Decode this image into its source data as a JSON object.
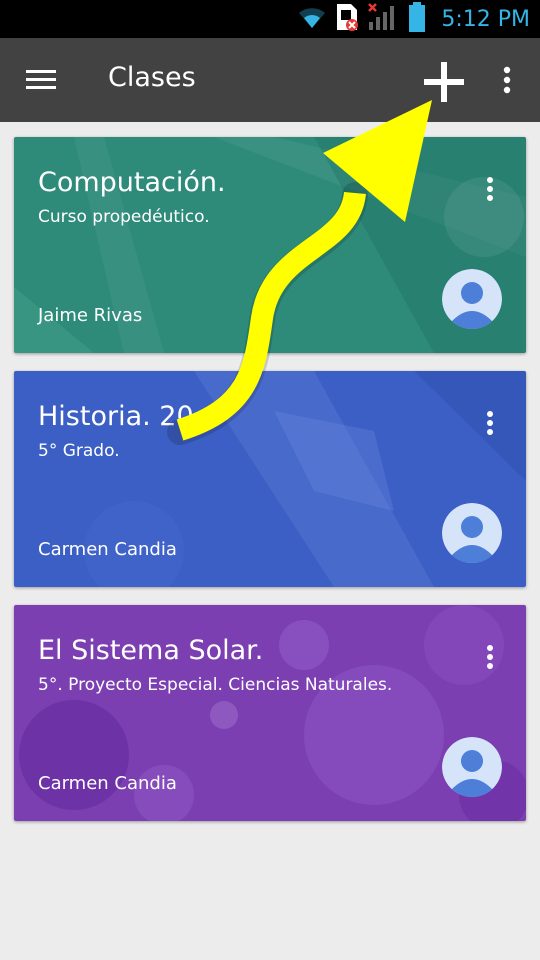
{
  "status_bar": {
    "time": "5:12 PM",
    "icons": [
      "wifi-icon",
      "sim-error-icon",
      "signal-off-icon",
      "battery-icon"
    ]
  },
  "app_bar": {
    "title": "Clases",
    "menu_icon": "hamburger-menu-icon",
    "add_icon": "plus-icon",
    "overflow_icon": "more-vert-icon"
  },
  "classes": [
    {
      "title": "Computación.",
      "subtitle": "Curso propedéutico.",
      "owner": "Jaime Rivas",
      "color": "#2e8b7a"
    },
    {
      "title": "Historia. 20",
      "subtitle": "5° Grado.",
      "owner": "Carmen Candia",
      "color": "#3b5fc4"
    },
    {
      "title": "El Sistema Solar.",
      "subtitle": "5°. Proyecto Especial. Ciencias Naturales.",
      "owner": "Carmen Candia",
      "color": "#7b3fb2"
    }
  ],
  "colors": {
    "app_bar": "#424242",
    "background": "#ececec",
    "status_accent": "#34b5e5",
    "avatar_bg": "#d6e4fa",
    "avatar_fg": "#4d7fd9",
    "annotation_arrow": "#ffff00"
  }
}
